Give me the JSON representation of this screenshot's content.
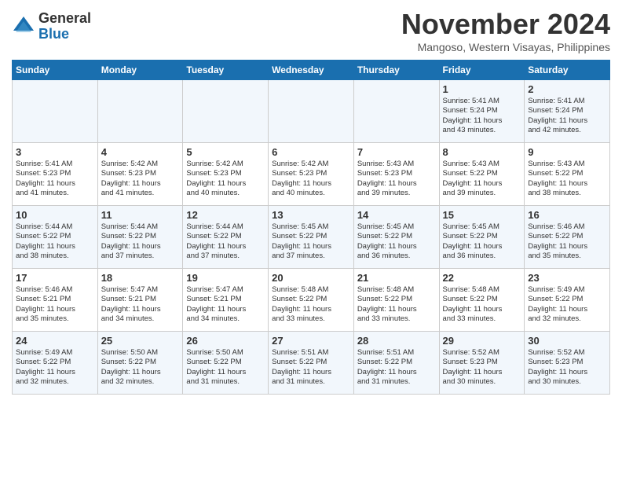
{
  "header": {
    "logo_line1": "General",
    "logo_line2": "Blue",
    "month": "November 2024",
    "location": "Mangoso, Western Visayas, Philippines"
  },
  "days_of_week": [
    "Sunday",
    "Monday",
    "Tuesday",
    "Wednesday",
    "Thursday",
    "Friday",
    "Saturday"
  ],
  "weeks": [
    [
      {
        "day": "",
        "info": ""
      },
      {
        "day": "",
        "info": ""
      },
      {
        "day": "",
        "info": ""
      },
      {
        "day": "",
        "info": ""
      },
      {
        "day": "",
        "info": ""
      },
      {
        "day": "1",
        "info": "Sunrise: 5:41 AM\nSunset: 5:24 PM\nDaylight: 11 hours\nand 43 minutes."
      },
      {
        "day": "2",
        "info": "Sunrise: 5:41 AM\nSunset: 5:24 PM\nDaylight: 11 hours\nand 42 minutes."
      }
    ],
    [
      {
        "day": "3",
        "info": "Sunrise: 5:41 AM\nSunset: 5:23 PM\nDaylight: 11 hours\nand 41 minutes."
      },
      {
        "day": "4",
        "info": "Sunrise: 5:42 AM\nSunset: 5:23 PM\nDaylight: 11 hours\nand 41 minutes."
      },
      {
        "day": "5",
        "info": "Sunrise: 5:42 AM\nSunset: 5:23 PM\nDaylight: 11 hours\nand 40 minutes."
      },
      {
        "day": "6",
        "info": "Sunrise: 5:42 AM\nSunset: 5:23 PM\nDaylight: 11 hours\nand 40 minutes."
      },
      {
        "day": "7",
        "info": "Sunrise: 5:43 AM\nSunset: 5:23 PM\nDaylight: 11 hours\nand 39 minutes."
      },
      {
        "day": "8",
        "info": "Sunrise: 5:43 AM\nSunset: 5:22 PM\nDaylight: 11 hours\nand 39 minutes."
      },
      {
        "day": "9",
        "info": "Sunrise: 5:43 AM\nSunset: 5:22 PM\nDaylight: 11 hours\nand 38 minutes."
      }
    ],
    [
      {
        "day": "10",
        "info": "Sunrise: 5:44 AM\nSunset: 5:22 PM\nDaylight: 11 hours\nand 38 minutes."
      },
      {
        "day": "11",
        "info": "Sunrise: 5:44 AM\nSunset: 5:22 PM\nDaylight: 11 hours\nand 37 minutes."
      },
      {
        "day": "12",
        "info": "Sunrise: 5:44 AM\nSunset: 5:22 PM\nDaylight: 11 hours\nand 37 minutes."
      },
      {
        "day": "13",
        "info": "Sunrise: 5:45 AM\nSunset: 5:22 PM\nDaylight: 11 hours\nand 37 minutes."
      },
      {
        "day": "14",
        "info": "Sunrise: 5:45 AM\nSunset: 5:22 PM\nDaylight: 11 hours\nand 36 minutes."
      },
      {
        "day": "15",
        "info": "Sunrise: 5:45 AM\nSunset: 5:22 PM\nDaylight: 11 hours\nand 36 minutes."
      },
      {
        "day": "16",
        "info": "Sunrise: 5:46 AM\nSunset: 5:22 PM\nDaylight: 11 hours\nand 35 minutes."
      }
    ],
    [
      {
        "day": "17",
        "info": "Sunrise: 5:46 AM\nSunset: 5:21 PM\nDaylight: 11 hours\nand 35 minutes."
      },
      {
        "day": "18",
        "info": "Sunrise: 5:47 AM\nSunset: 5:21 PM\nDaylight: 11 hours\nand 34 minutes."
      },
      {
        "day": "19",
        "info": "Sunrise: 5:47 AM\nSunset: 5:21 PM\nDaylight: 11 hours\nand 34 minutes."
      },
      {
        "day": "20",
        "info": "Sunrise: 5:48 AM\nSunset: 5:22 PM\nDaylight: 11 hours\nand 33 minutes."
      },
      {
        "day": "21",
        "info": "Sunrise: 5:48 AM\nSunset: 5:22 PM\nDaylight: 11 hours\nand 33 minutes."
      },
      {
        "day": "22",
        "info": "Sunrise: 5:48 AM\nSunset: 5:22 PM\nDaylight: 11 hours\nand 33 minutes."
      },
      {
        "day": "23",
        "info": "Sunrise: 5:49 AM\nSunset: 5:22 PM\nDaylight: 11 hours\nand 32 minutes."
      }
    ],
    [
      {
        "day": "24",
        "info": "Sunrise: 5:49 AM\nSunset: 5:22 PM\nDaylight: 11 hours\nand 32 minutes."
      },
      {
        "day": "25",
        "info": "Sunrise: 5:50 AM\nSunset: 5:22 PM\nDaylight: 11 hours\nand 32 minutes."
      },
      {
        "day": "26",
        "info": "Sunrise: 5:50 AM\nSunset: 5:22 PM\nDaylight: 11 hours\nand 31 minutes."
      },
      {
        "day": "27",
        "info": "Sunrise: 5:51 AM\nSunset: 5:22 PM\nDaylight: 11 hours\nand 31 minutes."
      },
      {
        "day": "28",
        "info": "Sunrise: 5:51 AM\nSunset: 5:22 PM\nDaylight: 11 hours\nand 31 minutes."
      },
      {
        "day": "29",
        "info": "Sunrise: 5:52 AM\nSunset: 5:23 PM\nDaylight: 11 hours\nand 30 minutes."
      },
      {
        "day": "30",
        "info": "Sunrise: 5:52 AM\nSunset: 5:23 PM\nDaylight: 11 hours\nand 30 minutes."
      }
    ]
  ]
}
